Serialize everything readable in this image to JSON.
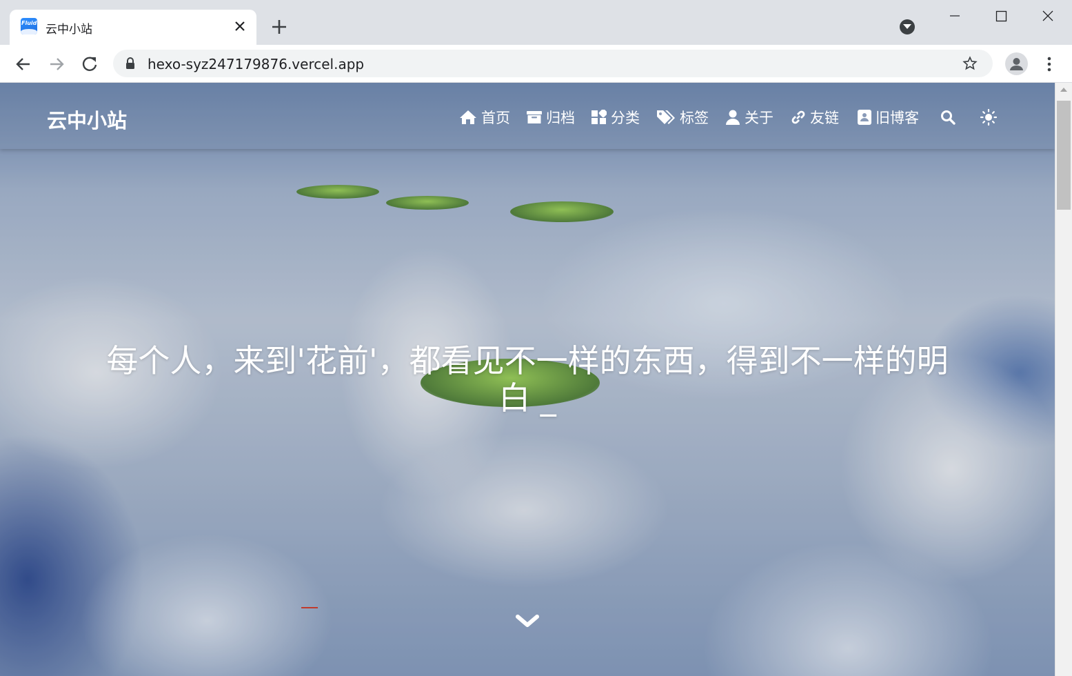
{
  "browser": {
    "tab_title": "云中小站",
    "favicon_text": "Fluid",
    "url": "hexo-syz247179876.vercel.app"
  },
  "site": {
    "brand": "云中小站",
    "nav": [
      {
        "label": "首页",
        "icon": "home-icon"
      },
      {
        "label": "归档",
        "icon": "archive-icon"
      },
      {
        "label": "分类",
        "icon": "category-icon"
      },
      {
        "label": "标签",
        "icon": "tags-icon"
      },
      {
        "label": "关于",
        "icon": "user-icon"
      },
      {
        "label": "友链",
        "icon": "link-icon"
      },
      {
        "label": "旧博客",
        "icon": "address-book-icon"
      }
    ],
    "hero_line1": "每个人，来到'花前'，都看见不一样的东西，得到不一样的明",
    "hero_line2": "白 _"
  },
  "colors": {
    "chrome_bg": "#dee1e6",
    "toolbar_bg": "#ffffff",
    "omnibox_bg": "#f1f3f4",
    "nav_text": "#ffffff"
  }
}
